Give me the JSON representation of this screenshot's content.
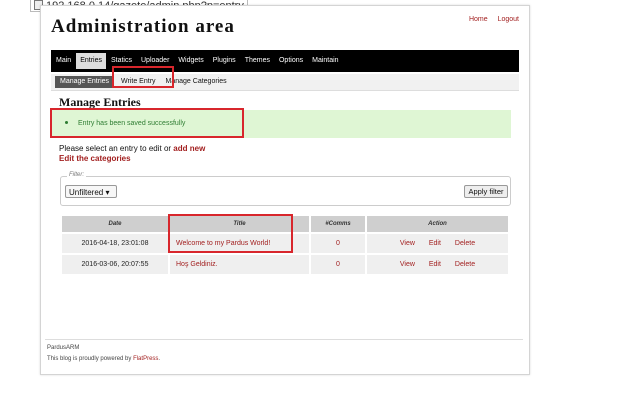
{
  "browser": {
    "url": "192.168.0.14/gazete/admin.php?p=entry"
  },
  "header": {
    "title": "Administration area",
    "links": [
      "Home",
      "Logout"
    ]
  },
  "nav": {
    "items": [
      "Main",
      "Entries",
      "Statics",
      "Uploader",
      "Widgets",
      "Plugins",
      "Themes",
      "Options",
      "Maintain"
    ],
    "active": "Entries"
  },
  "subnav": {
    "items": [
      "Manage Entries",
      "Write Entry",
      "Manage Categories"
    ],
    "active": "Manage Entries"
  },
  "page": {
    "heading": "Manage Entries",
    "success_message": "Entry has been saved successfully",
    "instruction_prefix": "Please select an entry to edit or",
    "add_new": "add new",
    "edit_categories": "Edit the categories"
  },
  "filter": {
    "legend": "Filter:",
    "selected": "Unfiltered",
    "apply_label": "Apply filter"
  },
  "table": {
    "headers": [
      "Date",
      "Title",
      "#Comms",
      "Action"
    ],
    "rows": [
      {
        "date": "2016-04-18, 23:01:08",
        "title": "Welcome to my Pardus World!",
        "comments": "0",
        "actions": [
          "View",
          "Edit",
          "Delete"
        ]
      },
      {
        "date": "2016-03-06, 20:07:55",
        "title": "Hoş Geldiniz.",
        "comments": "0",
        "actions": [
          "View",
          "Edit",
          "Delete"
        ]
      }
    ]
  },
  "footer": {
    "site_name": "PardusARM",
    "powered_prefix": "This blog is proudly powered by",
    "powered_link": "FlatPress",
    "powered_suffix": "."
  },
  "colors": {
    "link": "#a21f1f",
    "highlight": "#d8262c",
    "success_bg": "#dff6d4"
  }
}
